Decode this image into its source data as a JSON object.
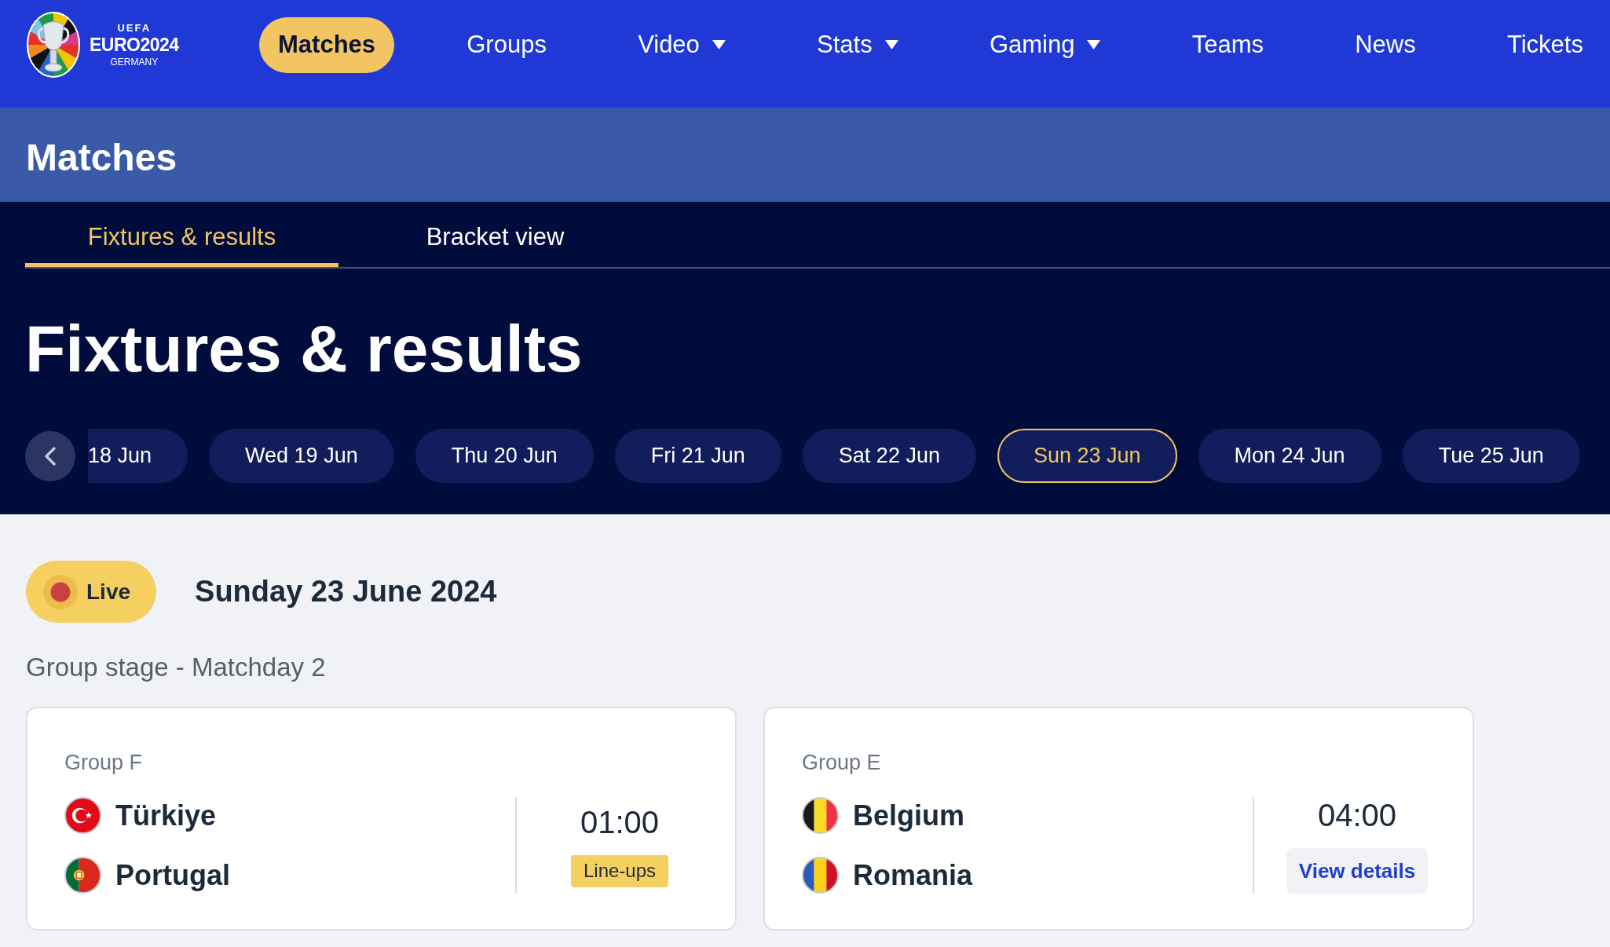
{
  "logo": {
    "arc": "UEFA",
    "wordmark": "EURO2024",
    "host": "GERMANY"
  },
  "nav": [
    {
      "label": "Matches",
      "selected": true,
      "dropdown": false
    },
    {
      "label": "Groups",
      "selected": false,
      "dropdown": false
    },
    {
      "label": "Video",
      "selected": false,
      "dropdown": true
    },
    {
      "label": "Stats",
      "selected": false,
      "dropdown": true
    },
    {
      "label": "Gaming",
      "selected": false,
      "dropdown": true
    },
    {
      "label": "Teams",
      "selected": false,
      "dropdown": false
    },
    {
      "label": "News",
      "selected": false,
      "dropdown": false
    },
    {
      "label": "Tickets",
      "selected": false,
      "dropdown": false
    }
  ],
  "page_title": "Matches",
  "tabs": [
    {
      "label": "Fixtures & results",
      "selected": true
    },
    {
      "label": "Bracket view",
      "selected": false
    }
  ],
  "heading": "Fixtures & results",
  "date_strip": {
    "dates": [
      {
        "label": "18 Jun",
        "selected": false
      },
      {
        "label": "Wed 19 Jun",
        "selected": false
      },
      {
        "label": "Thu 20 Jun",
        "selected": false
      },
      {
        "label": "Fri 21 Jun",
        "selected": false
      },
      {
        "label": "Sat 22 Jun",
        "selected": false
      },
      {
        "label": "Sun 23 Jun",
        "selected": true
      },
      {
        "label": "Mon 24 Jun",
        "selected": false
      },
      {
        "label": "Tue 25 Jun",
        "selected": false
      }
    ]
  },
  "day": {
    "live_filter": {
      "label": "Live"
    },
    "date": "Sunday 23 June 2024",
    "stage": "Group stage - Matchday 2",
    "matches": [
      {
        "group": "Group F",
        "teams": [
          {
            "name": "Türkiye",
            "kind": "tr"
          },
          {
            "name": "Portugal",
            "kind": "pt"
          }
        ],
        "time": "01:00",
        "action": {
          "kind": "lineups",
          "label": "Line-ups"
        }
      },
      {
        "group": "Group E",
        "teams": [
          {
            "name": "Belgium",
            "kind": "be"
          },
          {
            "name": "Romania",
            "kind": "ro"
          }
        ],
        "time": "04:00",
        "action": {
          "kind": "details",
          "label": "View details"
        }
      }
    ]
  }
}
